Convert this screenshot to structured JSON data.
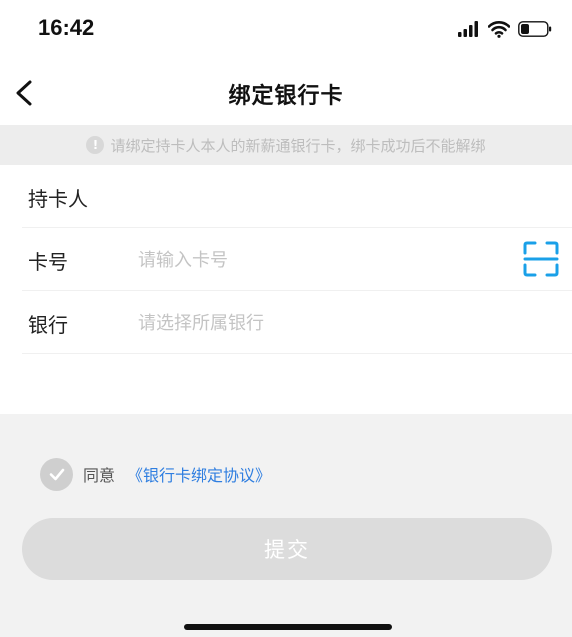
{
  "status_bar": {
    "time": "16:42"
  },
  "nav": {
    "title": "绑定银行卡"
  },
  "notice": {
    "icon": "!",
    "text": "请绑定持卡人本人的新薪通银行卡，绑卡成功后不能解绑"
  },
  "form": {
    "holder": {
      "label": "持卡人",
      "value": ""
    },
    "card": {
      "label": "卡号",
      "placeholder": "请输入卡号",
      "value": ""
    },
    "bank": {
      "label": "银行",
      "placeholder": "请选择所属银行",
      "value": ""
    }
  },
  "agreement": {
    "prefix": "同意",
    "link": "《银行卡绑定协议》",
    "checked": true
  },
  "submit": {
    "label": "提交",
    "enabled": false
  },
  "colors": {
    "accent": "#2f7ee0",
    "scan_icon": "#1aa0e8",
    "disabled_button": "#dcdcdc"
  }
}
